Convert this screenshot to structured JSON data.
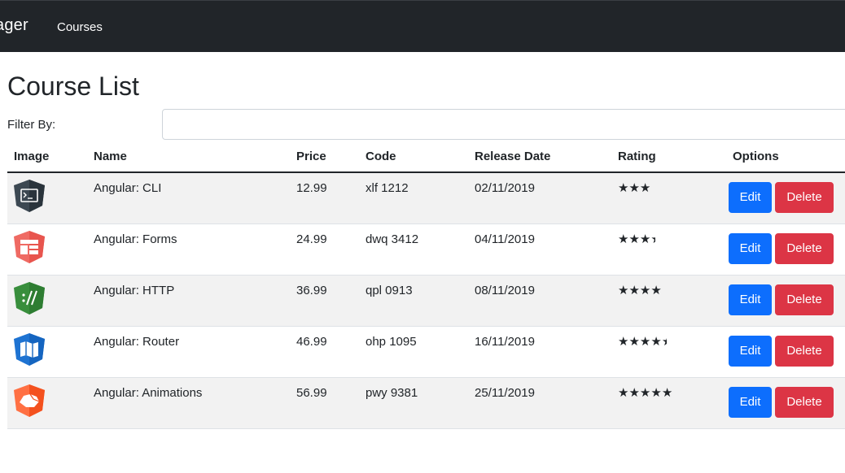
{
  "navbar": {
    "brand": "ager",
    "link_courses": "Courses"
  },
  "page": {
    "title": "Course List",
    "filter_label": "Filter By:",
    "filter_value": ""
  },
  "table": {
    "headers": [
      "Image",
      "Name",
      "Price",
      "Code",
      "Release Date",
      "Rating",
      "Options"
    ],
    "edit_label": "Edit",
    "delete_label": "Delete",
    "rows": [
      {
        "icon": "terminal-icon",
        "icon_color": "#3c4852",
        "name": "Angular: CLI",
        "price": "12.99",
        "code": "xlf 1212",
        "date": "02/11/2019",
        "rating": 3
      },
      {
        "icon": "form-layout-icon",
        "icon_color": "#e8554e",
        "name": "Angular: Forms",
        "price": "24.99",
        "code": "dwq 3412",
        "date": "04/11/2019",
        "rating": 3.5
      },
      {
        "icon": "http-slashes-icon",
        "icon_color": "#2e7d32",
        "name": "Angular: HTTP",
        "price": "36.99",
        "code": "qpl 0913",
        "date": "08/11/2019",
        "rating": 4
      },
      {
        "icon": "router-map-icon",
        "icon_color": "#1565c0",
        "name": "Angular: Router",
        "price": "46.99",
        "code": "ohp 1095",
        "date": "16/11/2019",
        "rating": 4.5
      },
      {
        "icon": "animation-shape-icon",
        "icon_color": "#f4511e",
        "name": "Angular: Animations",
        "price": "56.99",
        "code": "pwy 9381",
        "date": "25/11/2019",
        "rating": 5
      }
    ]
  }
}
